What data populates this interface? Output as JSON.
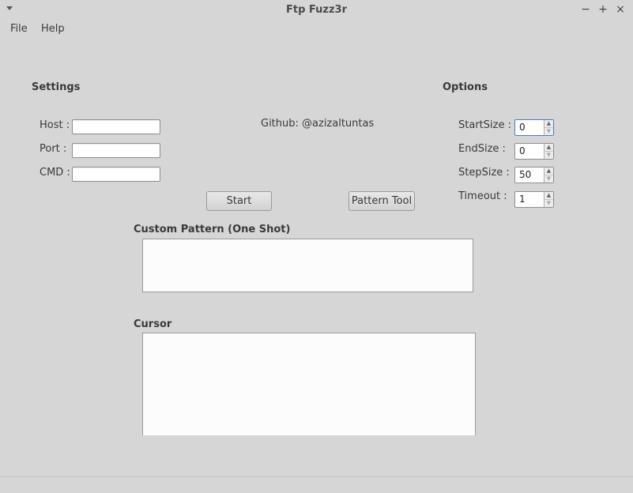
{
  "window": {
    "title": "Ftp Fuzz3r",
    "controls": {
      "minimize": "−",
      "maximize": "+",
      "close": "×"
    }
  },
  "menubar": {
    "file": "File",
    "help": "Help"
  },
  "settings": {
    "heading": "Settings",
    "host_label": "Host :",
    "port_label": "Port  :",
    "cmd_label": "CMD :",
    "host_value": "",
    "port_value": "",
    "cmd_value": ""
  },
  "github": "Github: @azizaltuntas",
  "buttons": {
    "start": "Start",
    "pattern_tool": "Pattern Tool"
  },
  "options": {
    "heading": "Options",
    "startsize_label": "StartSize :",
    "endsize_label": "EndSize   :",
    "stepsize_label": "StepSize  :",
    "timeout_label": "Timeout  :",
    "startsize_value": "0",
    "endsize_value": "0",
    "stepsize_value": "50",
    "timeout_value": "1"
  },
  "custom_pattern": {
    "label": "Custom Pattern (One Shot)",
    "value": ""
  },
  "cursor": {
    "label": "Cursor",
    "value": ""
  }
}
